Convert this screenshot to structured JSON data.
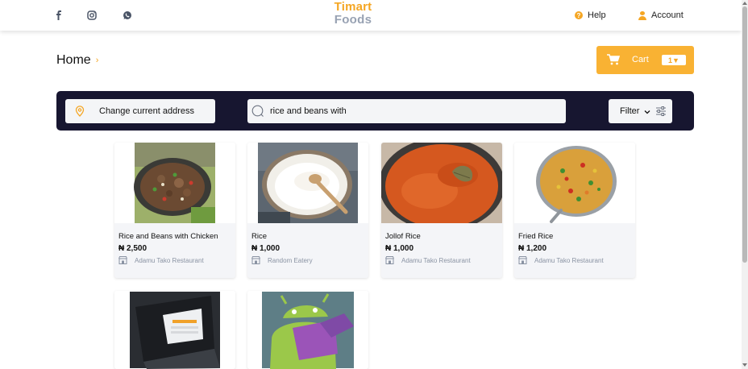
{
  "header": {
    "logo_top": "Timart",
    "logo_bottom": "Foods",
    "social_icons": [
      "facebook-icon",
      "instagram-icon",
      "whatsapp-icon"
    ],
    "help_label": "Help",
    "account_label": "Account",
    "accent_color": "#f5a623"
  },
  "breadcrumb": {
    "home": "Home",
    "separator": "›"
  },
  "cart": {
    "label": "Cart",
    "count": "1▼"
  },
  "search": {
    "address_label": "Change current address",
    "query": "rice and beans with",
    "filter_label": "Filter"
  },
  "products": [
    {
      "name": "Rice and Beans with Chicken",
      "price": "₦ 2,500",
      "store": "Adamu Tako Restaurant"
    },
    {
      "name": "Rice",
      "price": "₦ 1,000",
      "store": "Random Eatery"
    },
    {
      "name": "Jollof Rice",
      "price": "₦ 1,000",
      "store": "Adamu Tako Restaurant"
    },
    {
      "name": "Fried Rice",
      "price": "₦ 1,200",
      "store": "Adamu Tako Restaurant"
    }
  ],
  "colors": {
    "search_bar_bg": "#171630",
    "cart_bg": "#f9b233"
  }
}
